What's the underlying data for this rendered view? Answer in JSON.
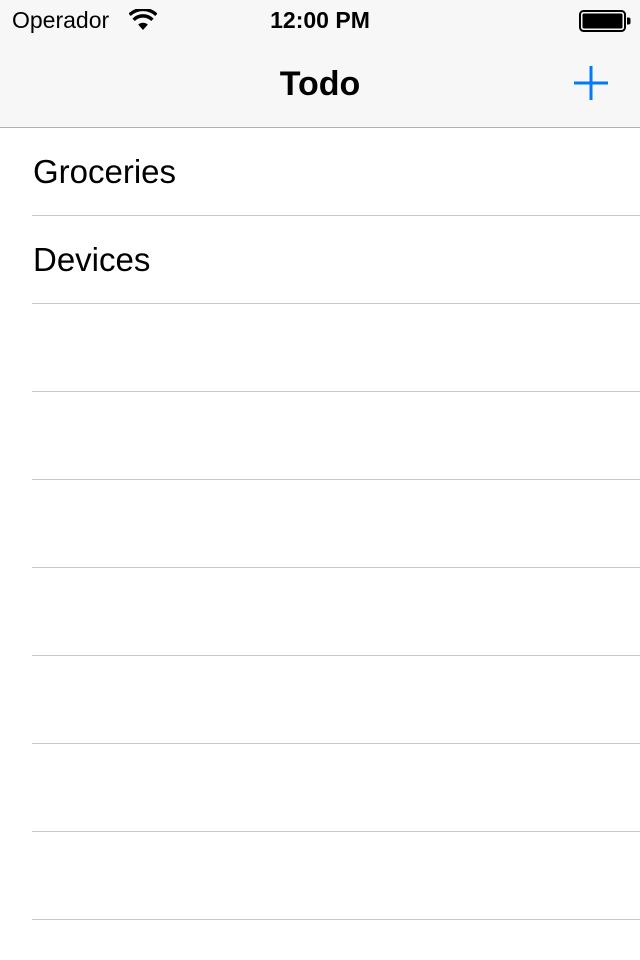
{
  "status_bar": {
    "carrier": "Operador",
    "time": "12:00 PM",
    "wifi_icon": "wifi-icon",
    "battery_icon": "battery-icon"
  },
  "nav": {
    "title": "Todo",
    "add_icon": "plus-icon",
    "tint_color": "#007aff"
  },
  "list": {
    "items": [
      {
        "label": "Groceries"
      },
      {
        "label": "Devices"
      },
      {
        "label": ""
      },
      {
        "label": ""
      },
      {
        "label": ""
      },
      {
        "label": ""
      },
      {
        "label": ""
      },
      {
        "label": ""
      },
      {
        "label": ""
      }
    ]
  }
}
